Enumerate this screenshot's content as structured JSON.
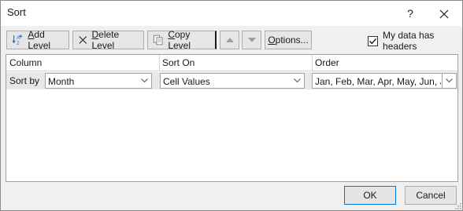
{
  "window": {
    "title": "Sort",
    "help_glyph": "?"
  },
  "toolbar": {
    "add_level": {
      "accel": "A",
      "rest": "dd Level"
    },
    "delete_level": {
      "accel": "D",
      "rest": "elete Level"
    },
    "copy_level": {
      "accel": "C",
      "rest": "opy Level"
    },
    "options": {
      "accel": "O",
      "rest": "ptions..."
    }
  },
  "headers_checkbox": {
    "label_pre": "My data has ",
    "label_accel": "h",
    "label_post": "eaders",
    "checked": true
  },
  "grid": {
    "columns": [
      "Column",
      "Sort On",
      "Order"
    ],
    "rows": [
      {
        "label": "Sort by",
        "column": "Month",
        "sort_on": "Cell Values",
        "order": "Jan, Feb, Mar, Apr, May, Jun, Jul, A"
      }
    ]
  },
  "footer": {
    "ok": "OK",
    "cancel": "Cancel"
  },
  "colors": {
    "accent": "#0078d7",
    "selected_row": "#e8e8e8",
    "add_icon_blue": "#2e6fc0"
  }
}
